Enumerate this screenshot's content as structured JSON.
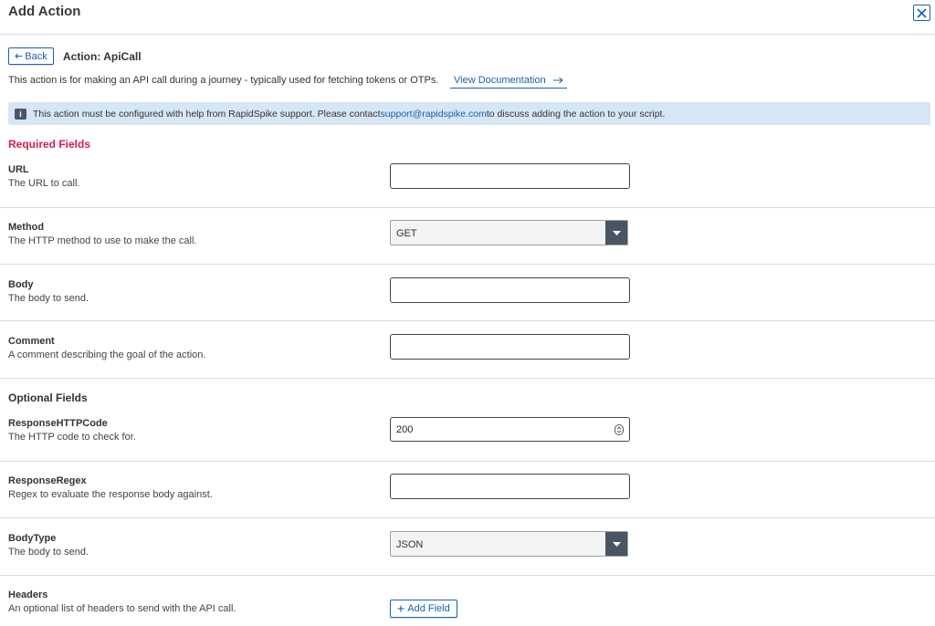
{
  "dialog": {
    "title": "Add Action",
    "close_icon": "close-icon"
  },
  "action": {
    "back_label": "Back",
    "back_icon": "arrow-left-icon",
    "title": "Action: ApiCall",
    "description": "This action is for making an API call during a journey - typically used for fetching tokens or OTPs.",
    "doc_link_label": "View Documentation",
    "doc_link_icon": "arrow-right-icon"
  },
  "info": {
    "badge": "i",
    "text_before": "This action must be configured with help from RapidSpike support. Please contact ",
    "link": "support@rapidspike.com",
    "text_after": " to discuss adding the action to your script.",
    "background": "#d7e6f5"
  },
  "sections": {
    "required": "Required Fields",
    "optional": "Optional Fields",
    "required_color": "#d81b4a"
  },
  "fields": {
    "url": {
      "label": "URL",
      "help": "The URL to call.",
      "value": ""
    },
    "method": {
      "label": "Method",
      "help": "The HTTP method to use to make the call.",
      "value": "GET"
    },
    "body": {
      "label": "Body",
      "help": "The body to send.",
      "value": ""
    },
    "comment": {
      "label": "Comment",
      "help": "A comment describing the goal of the action.",
      "value": ""
    },
    "response_http_code": {
      "label": "ResponseHTTPCode",
      "help": "The HTTP code to check for.",
      "value": "200"
    },
    "response_regex": {
      "label": "ResponseRegex",
      "help": "Regex to evaluate the response body against.",
      "value": ""
    },
    "body_type": {
      "label": "BodyType",
      "help": "The body to send.",
      "value": "JSON"
    },
    "headers": {
      "label": "Headers",
      "help": "An optional list of headers to send with the API call.",
      "button_label": "Add Field",
      "button_icon": "plus-icon"
    }
  },
  "colors": {
    "accent": "#1a5fb4",
    "select_arrow_bg": "#4a5563"
  }
}
